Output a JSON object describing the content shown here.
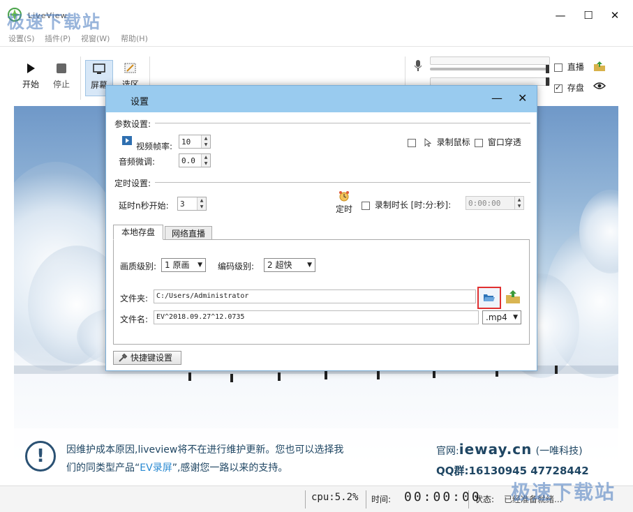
{
  "window": {
    "title": "LiveView",
    "minimize": "—",
    "maximize": "☐",
    "close": "✕"
  },
  "watermark": "极速下载站",
  "menu": {
    "items": [
      "设置(S)",
      "插件(P)",
      "视窗(W)",
      "帮助(H)"
    ]
  },
  "toolbar": {
    "start": "开始",
    "stop": "停止",
    "screen": "屏幕",
    "region": "选区",
    "live_label": "直播",
    "save_label": "存盘",
    "live_checked": false,
    "save_checked": true
  },
  "dialog": {
    "title": "设置",
    "minimize": "—",
    "close": "✕",
    "params_section": "参数设置:",
    "video_fps_label": "视频帧率:",
    "video_fps_value": "10",
    "audio_adjust_label": "音频微调:",
    "audio_adjust_value": "0.0",
    "record_mouse_label": "录制鼠标",
    "window_through_label": "窗口穿透",
    "timer_section": "定时设置:",
    "delay_label": "延时n秒开始:",
    "delay_value": "3",
    "timer_button": "定时",
    "record_duration_label": "录制时长 [时:分:秒]:",
    "duration_value": "0:00:00",
    "tabs": [
      "本地存盘",
      "网络直播"
    ],
    "quality_label": "画质级别:",
    "quality_value": "1 原画",
    "encode_label": "编码级别:",
    "encode_value": "2 超快",
    "folder_label": "文件夹:",
    "folder_value": "C:/Users/Administrator",
    "filename_label": "文件名:",
    "filename_value": "EV^2018.09.27^12.0735",
    "ext_value": ".mp4",
    "hotkey_button": "快捷键设置"
  },
  "notice": {
    "line1": "因维护成本原因,liveview将不在进行维护更新。您也可以选择我",
    "line2_a": "们的同类型产品“",
    "line2_hl": "EV录屏",
    "line2_b": "”,感谢您一路以来的支持。",
    "site_label": "官网:",
    "site_value": "ieway.cn",
    "site_company": "(一唯科技)",
    "qq_label": "QQ群:",
    "qq_value": "16130945 47728442"
  },
  "status": {
    "cpu": "cpu:5.2%",
    "time_label": "时间:",
    "time_value": "00:00:00",
    "state_label": "状态:",
    "state_value": "已经准备就绪..."
  },
  "colors": {
    "dialog_title": "#99cbef",
    "highlight_border": "#e03030",
    "notice_text": "#1f4663",
    "accent": "#2a8ad2"
  }
}
